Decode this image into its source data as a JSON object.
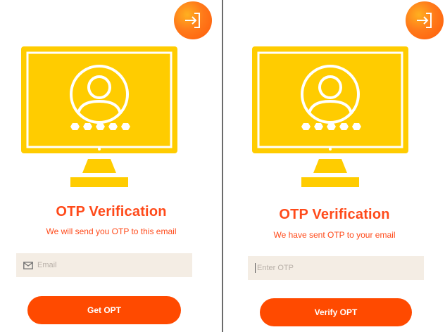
{
  "colors": {
    "accent": "#ff4a00",
    "title": "#ff4a1a",
    "monitor_yellow": "#ffcc00",
    "field_bg": "#f4ede4"
  },
  "screens": [
    {
      "title": "OTP Verification",
      "subtitle": "We will send you OTP to this email",
      "input": {
        "placeholder": "Email",
        "icon": "mail-icon"
      },
      "button_label": "Get OPT",
      "exit_icon": "logout-arrow-icon"
    },
    {
      "title": "OTP Verification",
      "subtitle": "We have sent OTP to your email",
      "input": {
        "placeholder": "Enter OTP"
      },
      "button_label": "Verify OPT",
      "exit_icon": "logout-arrow-icon"
    }
  ]
}
